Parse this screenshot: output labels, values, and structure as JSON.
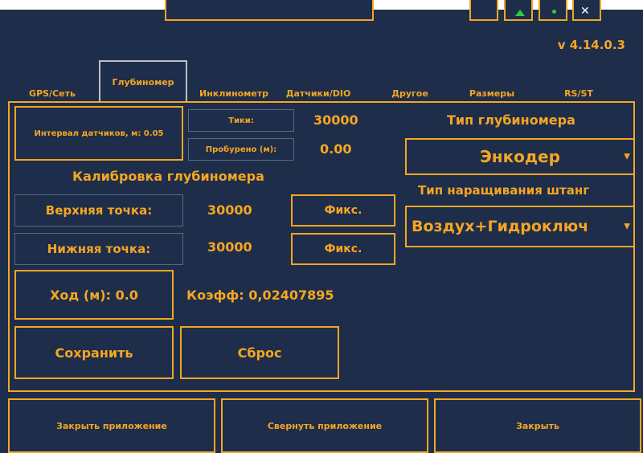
{
  "version": "v 4.14.0.3",
  "tabs": [
    {
      "label": "GPS/Сеть"
    },
    {
      "label": "Глубиномер"
    },
    {
      "label": "Инклинометр"
    },
    {
      "label": "Датчики/DIO"
    },
    {
      "label": "Другое"
    },
    {
      "label": "Размеры"
    },
    {
      "label": "RS/ST"
    }
  ],
  "active_tab": "Глубиномер",
  "sensor_interval": "Интервал датчиков, м: 0.05",
  "ticks": {
    "label": "Тики:",
    "value": "30000"
  },
  "drilled": {
    "label": "Пробурено (м):",
    "value": "0.00"
  },
  "calibration_title": "Калибровка глубиномера",
  "upper_point": {
    "label": "Верхняя точка:",
    "value": "30000",
    "fix_label": "Фикс."
  },
  "lower_point": {
    "label": "Нижняя точка:",
    "value": "30000",
    "fix_label": "Фикс."
  },
  "stroke": "Ход (м): 0.0",
  "coeff": "Коэфф: 0,02407895",
  "save_label": "Сохранить",
  "reset_label": "Сброс",
  "depth_type": {
    "title": "Тип глубиномера",
    "selected": "Энкодер"
  },
  "rod_type": {
    "title": "Тип наращивания штанг",
    "selected": "Воздух+Гидроключ"
  },
  "bottom": {
    "close_app": "Закрыть приложение",
    "minimize_app": "Свернуть приложение",
    "close": "Закрыть"
  },
  "colors": {
    "background": "#1e2d4a",
    "accent": "#f5a623",
    "inactive_border": "#5a6a85"
  }
}
